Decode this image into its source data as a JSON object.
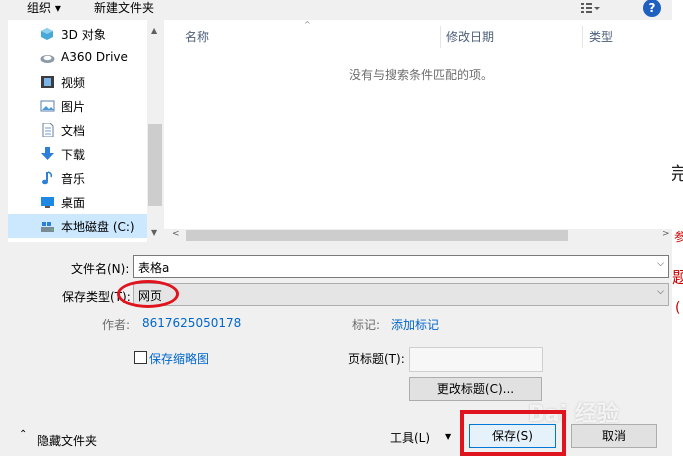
{
  "toolbar": {
    "organize": "组织 ▾",
    "new_folder": "新建文件夹",
    "help": "?"
  },
  "nav": {
    "items": [
      {
        "label": "3D 对象",
        "icon": "3d-objects-icon"
      },
      {
        "label": "A360 Drive",
        "icon": "a360-drive-icon"
      },
      {
        "label": "视频",
        "icon": "videos-icon"
      },
      {
        "label": "图片",
        "icon": "pictures-icon"
      },
      {
        "label": "文档",
        "icon": "documents-icon"
      },
      {
        "label": "下载",
        "icon": "downloads-icon"
      },
      {
        "label": "音乐",
        "icon": "music-icon"
      },
      {
        "label": "桌面",
        "icon": "desktop-icon"
      },
      {
        "label": "本地磁盘 (C:)",
        "icon": "local-disk-icon"
      }
    ]
  },
  "filelist": {
    "columns": [
      "名称",
      "修改日期",
      "类型"
    ],
    "empty_message": "没有与搜索条件匹配的项。"
  },
  "form": {
    "filename_label": "文件名(N):",
    "filename_value": "表格a",
    "filetype_label": "保存类型(T):",
    "filetype_value": "网页",
    "author_label": "作者:",
    "author_value": "8617625050178",
    "tags_label": "标记:",
    "tags_value": "添加标记",
    "thumbnail_label": "保存缩略图",
    "page_title_label": "页标题(T):",
    "page_title_value": "",
    "change_title_button": "更改标题(C)..."
  },
  "footer": {
    "hide_folders": "隐藏文件夹",
    "tools": "工具(L)",
    "save": "保存(S)",
    "cancel": "取消"
  },
  "background_doc": {
    "text1": "完",
    "text2": "参",
    "text3": "题",
    "text4": "("
  },
  "watermark": {
    "text": "Bai 经验"
  },
  "colors": {
    "annotation_red": "#e0141e",
    "selection": "#cce8ff",
    "link": "#0066cc",
    "help_blue": "#1f5fbf"
  }
}
